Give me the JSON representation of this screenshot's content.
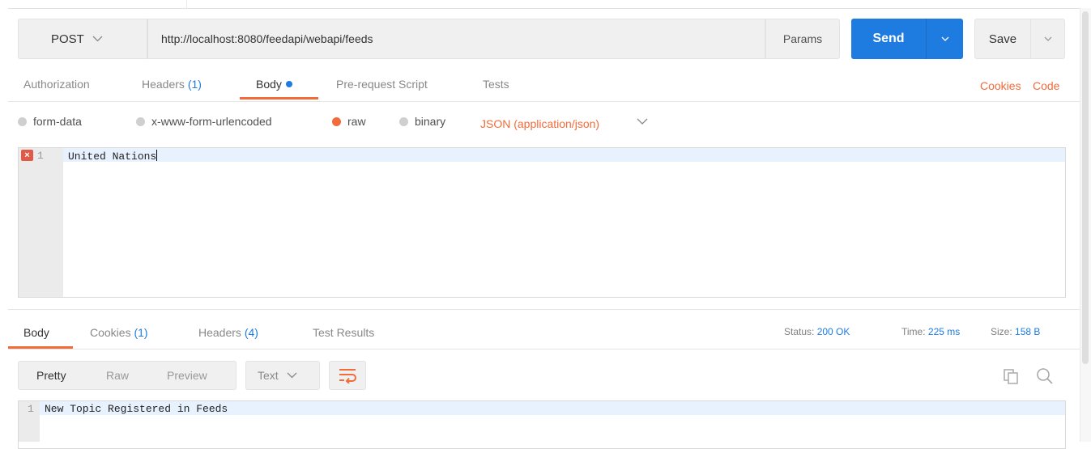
{
  "request": {
    "method": "POST",
    "url": "http://localhost:8080/feedapi/webapi/feeds",
    "params_label": "Params",
    "send_label": "Send",
    "save_label": "Save"
  },
  "request_tabs": [
    {
      "label": "Authorization"
    },
    {
      "label": "Headers",
      "count": "(1)"
    },
    {
      "label": "Body"
    },
    {
      "label": "Pre-request Script"
    },
    {
      "label": "Tests"
    }
  ],
  "links": {
    "cookies": "Cookies",
    "code": "Code"
  },
  "body_types": [
    {
      "label": "form-data",
      "selected": false
    },
    {
      "label": "x-www-form-urlencoded",
      "selected": false
    },
    {
      "label": "raw",
      "selected": true
    },
    {
      "label": "binary",
      "selected": false
    }
  ],
  "content_type": "JSON (application/json)",
  "request_editor": {
    "line_number": "1",
    "text": "United Nations",
    "error_marker": "×"
  },
  "response_tabs": [
    {
      "label": "Body"
    },
    {
      "label": "Cookies",
      "count": "(1)"
    },
    {
      "label": "Headers",
      "count": "(4)"
    },
    {
      "label": "Test Results"
    }
  ],
  "status": {
    "status_label": "Status:",
    "status_value": "200 OK",
    "time_label": "Time:",
    "time_value": "225 ms",
    "size_label": "Size:",
    "size_value": "158 B"
  },
  "view_modes": {
    "pretty": "Pretty",
    "raw": "Raw",
    "preview": "Preview"
  },
  "format": "Text",
  "response_editor": {
    "line_number": "1",
    "text": "New Topic Registered in Feeds"
  },
  "colors": {
    "accent": "#f26b3a",
    "primary": "#1e7be0"
  }
}
